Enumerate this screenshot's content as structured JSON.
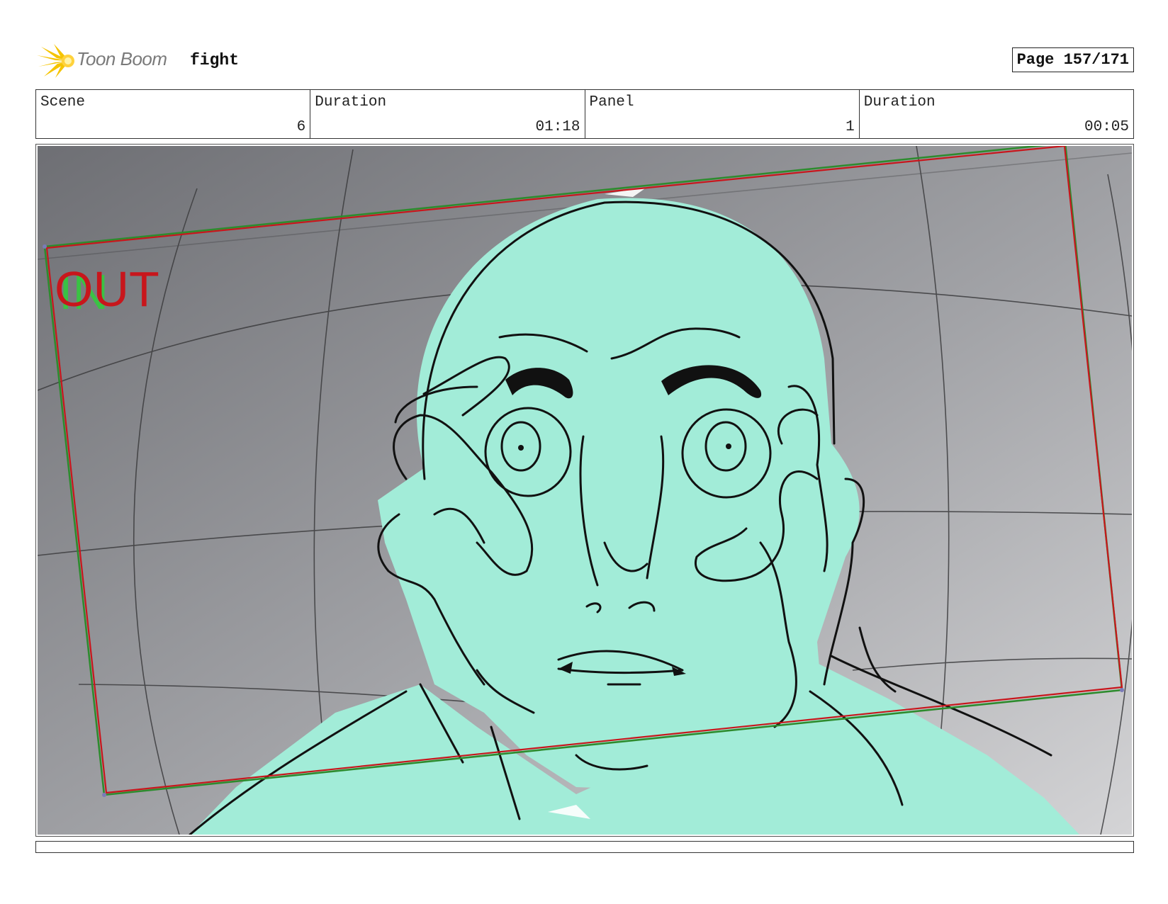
{
  "header": {
    "logo_text": "Toon Boom",
    "project_title": "fight",
    "page_label": "Page 157/171"
  },
  "info": {
    "scene_label": "Scene",
    "scene_value": "6",
    "scene_duration_label": "Duration",
    "scene_duration_value": "01:18",
    "panel_label": "Panel",
    "panel_value": "1",
    "panel_duration_label": "Duration",
    "panel_duration_value": "00:05"
  },
  "panel": {
    "camera_in_label": "IN",
    "camera_out_label": "OUT",
    "colors": {
      "character_fill": "#a2ecd8",
      "in_frame": "#2e8b2e",
      "out_frame": "#c8161c",
      "background_dark": "#6e6f74",
      "background_light": "#d4d4d6"
    }
  }
}
